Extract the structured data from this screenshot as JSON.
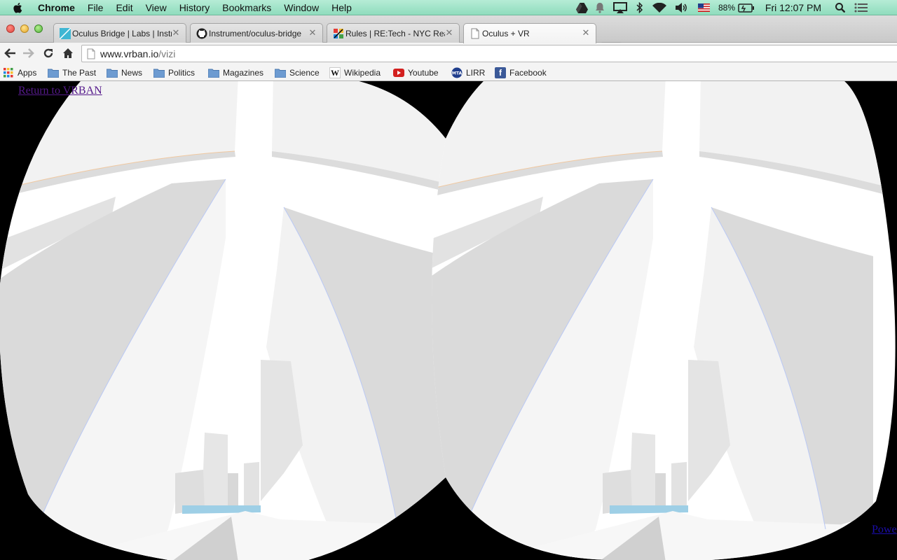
{
  "menubar": {
    "apple_icon": "apple-logo-icon",
    "app_name": "Chrome",
    "menus": [
      "File",
      "Edit",
      "View",
      "History",
      "Bookmarks",
      "Window",
      "Help"
    ],
    "battery": "88%",
    "clock": "Fri 12:07 PM"
  },
  "tabs": [
    {
      "title": "Oculus Bridge | Labs | Instrument",
      "favicon": "labs-favicon-icon",
      "active": false
    },
    {
      "title": "Instrument/oculus-bridge",
      "favicon": "github-icon",
      "active": false
    },
    {
      "title": "Rules | RE:Tech - NYC Real Estate",
      "favicon": "retech-favicon-icon",
      "active": false
    },
    {
      "title": "Oculus + VR",
      "favicon": "page-icon",
      "active": true
    }
  ],
  "toolbar": {
    "url_host": "www.vrban.io",
    "url_path": "/vizi"
  },
  "bookmarks": [
    {
      "label": "Apps",
      "icon": "apps-grid-icon"
    },
    {
      "label": "The Past",
      "icon": "folder-icon"
    },
    {
      "label": "News",
      "icon": "folder-icon"
    },
    {
      "label": "Politics",
      "icon": "folder-icon"
    },
    {
      "label": "Magazines",
      "icon": "folder-icon"
    },
    {
      "label": "Science",
      "icon": "folder-icon"
    },
    {
      "label": "Wikipedia",
      "icon": "wikipedia-icon"
    },
    {
      "label": "Youtube",
      "icon": "youtube-icon"
    },
    {
      "label": "LIRR",
      "icon": "mta-icon"
    },
    {
      "label": "Facebook",
      "icon": "facebook-icon"
    }
  ],
  "content": {
    "return_link": "Return to VRBAN",
    "power_link": "Powe"
  },
  "colors": {
    "menubar": "#9fe3c8",
    "link_visited": "#551a8b",
    "link": "#1a0dab",
    "scene_background": "#000000"
  }
}
